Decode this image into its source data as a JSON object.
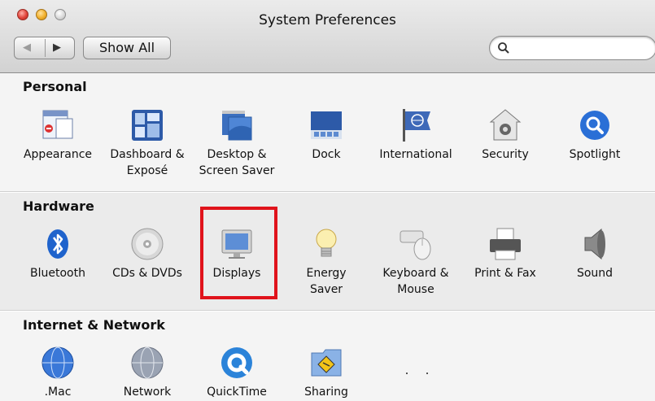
{
  "window": {
    "title": "System Preferences"
  },
  "toolbar": {
    "show_all_label": "Show All",
    "back_icon": "◀",
    "forward_icon": "▶",
    "search_icon": "magnifier",
    "search_value": ""
  },
  "sections": {
    "personal": {
      "title": "Personal",
      "items": [
        {
          "label": "Appearance",
          "icon": "appearance-icon"
        },
        {
          "label": "Dashboard &\nExposé",
          "icon": "dashboard-icon"
        },
        {
          "label": "Desktop &\nScreen Saver",
          "icon": "desktop-icon"
        },
        {
          "label": "Dock",
          "icon": "dock-icon"
        },
        {
          "label": "International",
          "icon": "international-icon"
        },
        {
          "label": "Security",
          "icon": "security-icon"
        },
        {
          "label": "Spotlight",
          "icon": "spotlight-icon"
        }
      ]
    },
    "hardware": {
      "title": "Hardware",
      "items": [
        {
          "label": "Bluetooth",
          "icon": "bluetooth-icon"
        },
        {
          "label": "CDs & DVDs",
          "icon": "cd-icon"
        },
        {
          "label": "Displays",
          "icon": "display-icon"
        },
        {
          "label": "Energy\nSaver",
          "icon": "lightbulb-icon"
        },
        {
          "label": "Keyboard &\nMouse",
          "icon": "keyboard-mouse-icon"
        },
        {
          "label": "Print & Fax",
          "icon": "printer-icon"
        },
        {
          "label": "Sound",
          "icon": "speaker-icon"
        }
      ]
    },
    "internet": {
      "title": "Internet & Network",
      "items": [
        {
          "label": ".Mac",
          "icon": "mac-globe-icon"
        },
        {
          "label": "Network",
          "icon": "network-icon"
        },
        {
          "label": "QuickTime",
          "icon": "quicktime-icon"
        },
        {
          "label": "Sharing",
          "icon": "sharing-icon"
        }
      ]
    }
  },
  "colors": {
    "highlight": "#e0131b",
    "accent_blue": "#2a6fd6"
  }
}
